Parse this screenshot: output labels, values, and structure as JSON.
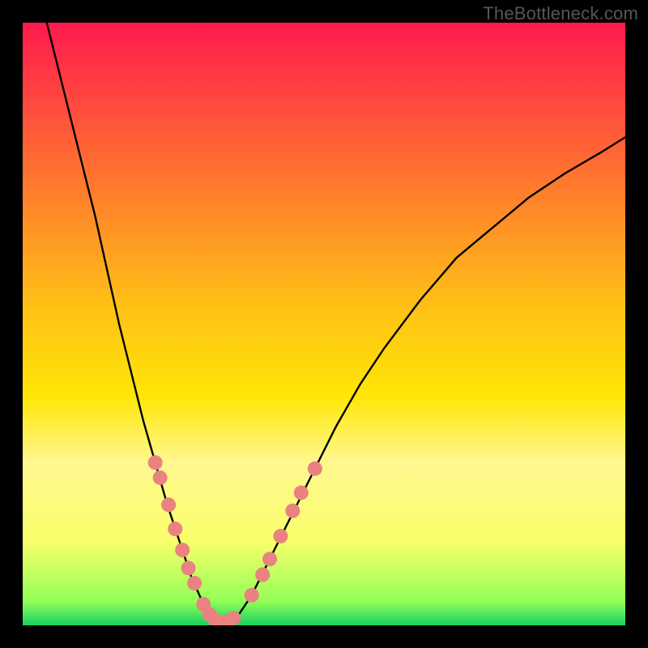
{
  "watermark": "TheBottleneck.com",
  "chart_data": {
    "type": "line",
    "title": "",
    "xlabel": "",
    "ylabel": "",
    "xlim": [
      0,
      100
    ],
    "ylim": [
      0,
      100
    ],
    "grid": false,
    "legend": false,
    "gradient_stops": [
      {
        "offset": 0,
        "color": "#ff1a4d"
      },
      {
        "offset": 46,
        "color": "#ffbd17"
      },
      {
        "offset": 62,
        "color": "#ffe607"
      },
      {
        "offset": 73,
        "color": "#fff88f"
      },
      {
        "offset": 86,
        "color": "#f9ff6a"
      },
      {
        "offset": 96,
        "color": "#93ff57"
      },
      {
        "offset": 100,
        "color": "#18d060"
      }
    ],
    "series": [
      {
        "name": "left-curve",
        "stroke": "#000000",
        "x": [
          4,
          6,
          8,
          10,
          12,
          14,
          16,
          18,
          20,
          22,
          24,
          26,
          28,
          30,
          31.5,
          33
        ],
        "y": [
          100,
          92,
          84,
          76,
          68,
          59,
          50,
          42,
          34,
          27,
          20,
          14,
          8,
          3.5,
          1.4,
          0.6
        ]
      },
      {
        "name": "right-curve",
        "stroke": "#000000",
        "x": [
          34,
          36,
          38,
          40,
          44,
          48,
          52,
          56,
          60,
          66,
          72,
          78,
          84,
          90,
          96,
          100
        ],
        "y": [
          0.6,
          2,
          5,
          9,
          17,
          25,
          33,
          40,
          46,
          54,
          61,
          66,
          71,
          75,
          78.5,
          81
        ]
      }
    ],
    "scatter": {
      "name": "markers",
      "color": "#e98281",
      "radius": 9,
      "points": [
        {
          "x": 22.0,
          "y": 27.0
        },
        {
          "x": 22.8,
          "y": 24.5
        },
        {
          "x": 24.2,
          "y": 20.0
        },
        {
          "x": 25.3,
          "y": 16.0
        },
        {
          "x": 26.5,
          "y": 12.5
        },
        {
          "x": 27.5,
          "y": 9.5
        },
        {
          "x": 28.5,
          "y": 7.0
        },
        {
          "x": 30.0,
          "y": 3.5
        },
        {
          "x": 31.0,
          "y": 1.8
        },
        {
          "x": 32.0,
          "y": 0.8
        },
        {
          "x": 33.5,
          "y": 0.6
        },
        {
          "x": 35.0,
          "y": 1.2
        },
        {
          "x": 38.0,
          "y": 5.0
        },
        {
          "x": 39.8,
          "y": 8.4
        },
        {
          "x": 41.0,
          "y": 11.0
        },
        {
          "x": 42.8,
          "y": 14.8
        },
        {
          "x": 44.8,
          "y": 19.0
        },
        {
          "x": 46.2,
          "y": 22.0
        },
        {
          "x": 48.5,
          "y": 26.0
        }
      ]
    }
  }
}
